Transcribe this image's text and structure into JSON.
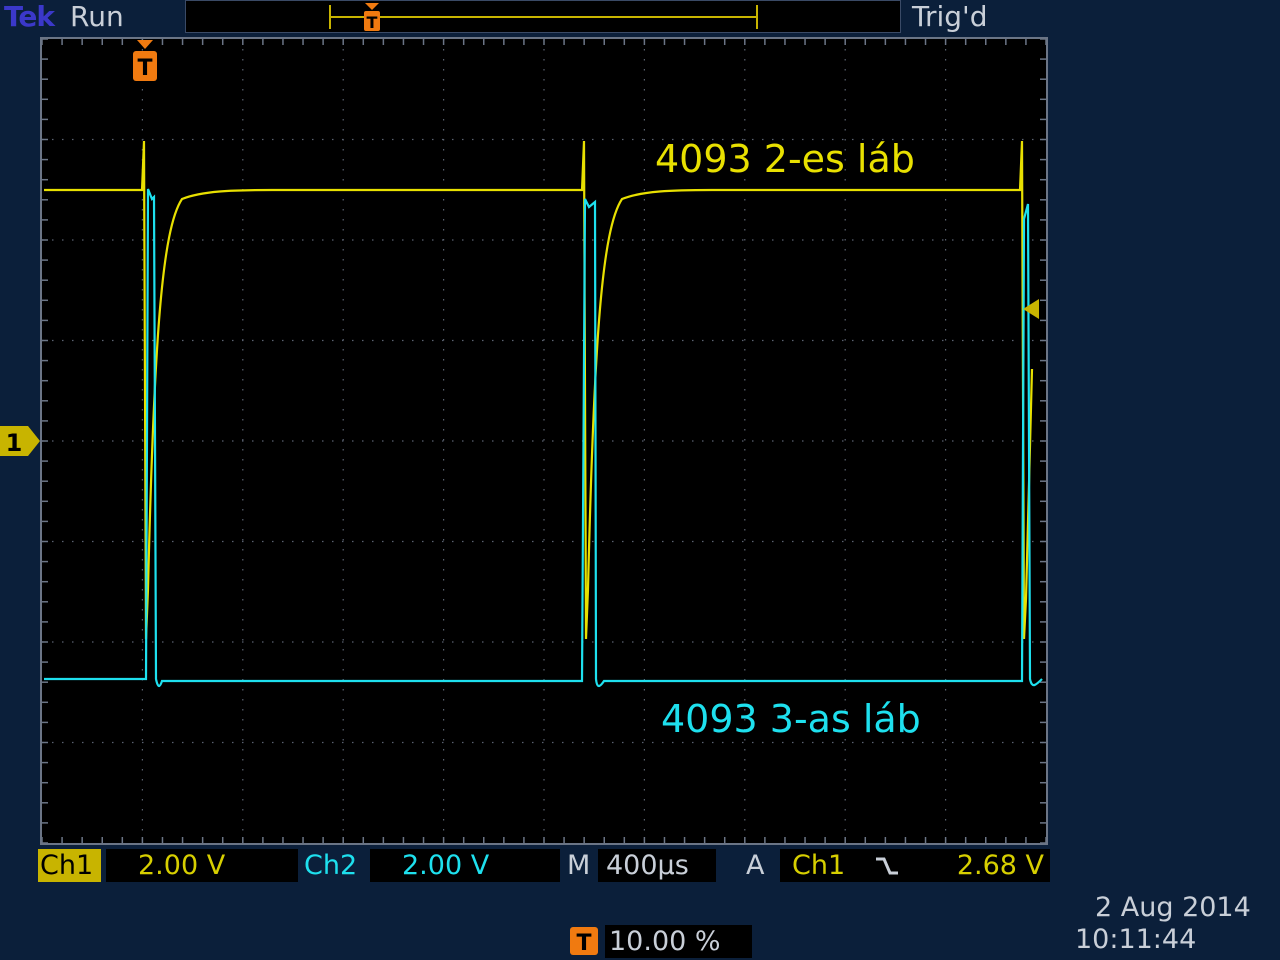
{
  "header": {
    "brand": "Tek",
    "run_status": "Run",
    "trigger_status": "Trig'd"
  },
  "traces": {
    "ch1_label": "4093  2-es láb",
    "ch2_label": "4093  3-as láb"
  },
  "markers": {
    "trigger_marker": "T",
    "ch1_ground_marker": "1"
  },
  "status_bar": {
    "ch1_tag": "Ch1",
    "ch1_scale": "2.00 V",
    "ch2_tag": "Ch2",
    "ch2_scale": "2.00 V",
    "timebase_tag": "M",
    "timebase": "400µs",
    "trigger_mode_tag": "A",
    "trigger_source": "Ch1",
    "trigger_slope_icon": "falling-edge-icon",
    "trigger_level": "2.68 V",
    "trigger_position_icon": "T",
    "trigger_position": "10.00 %",
    "date": "2 Aug 2014",
    "time": "10:11:44"
  },
  "colors": {
    "ch1": "#e8e000",
    "ch2": "#1ee0ee",
    "trigger": "#f07a10",
    "background": "#0b1f3a",
    "screen": "#000000"
  }
}
